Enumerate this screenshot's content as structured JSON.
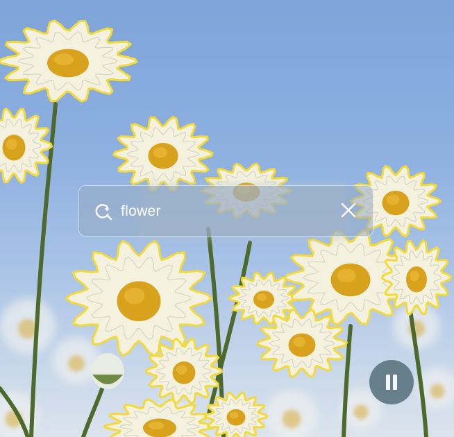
{
  "search": {
    "query": "flower"
  },
  "icons": {
    "search": "search-icon",
    "clear": "close-icon",
    "pause": "pause-icon"
  },
  "colors": {
    "highlight_outline": "#f2d93c",
    "petal": "#f4f2de",
    "flower_center": "#d9a21c",
    "stem": "#4d6a2c",
    "sky": "#86a9dc"
  },
  "detected_flowers": [
    {
      "label": "flower"
    },
    {
      "label": "flower"
    },
    {
      "label": "flower"
    },
    {
      "label": "flower"
    },
    {
      "label": "flower"
    },
    {
      "label": "flower"
    },
    {
      "label": "flower"
    },
    {
      "label": "flower"
    },
    {
      "label": "flower"
    },
    {
      "label": "flower"
    },
    {
      "label": "flower"
    },
    {
      "label": "flower"
    },
    {
      "label": "flower"
    }
  ]
}
